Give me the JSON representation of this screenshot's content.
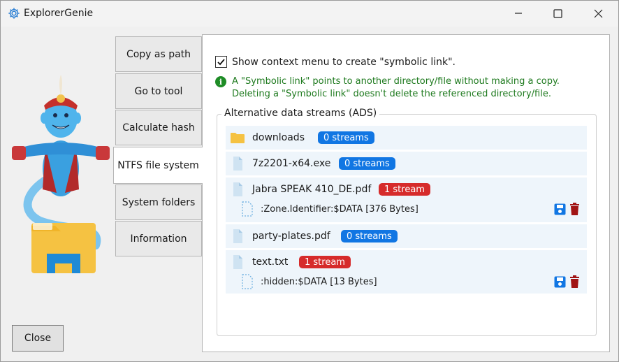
{
  "window": {
    "title": "ExplorerGenie"
  },
  "tabs": [
    {
      "label": "Copy as path"
    },
    {
      "label": "Go to tool"
    },
    {
      "label": "Calculate hash"
    },
    {
      "label": "NTFS file system"
    },
    {
      "label": "System folders"
    },
    {
      "label": "Information"
    }
  ],
  "active_tab": "NTFS file system",
  "panel": {
    "checkbox_label": "Show context menu to create \"symbolic link\".",
    "checkbox_checked": true,
    "info_text": "A \"Symbolic link\" points to another directory/file without making a copy. Deleting a \"Symbolic link\" doesn't delete the referenced directory/file.",
    "ads_title": "Alternative data streams (ADS)",
    "items": [
      {
        "name": "downloads",
        "badge": "0 streams",
        "badge_color": "#1176e3",
        "kind": "folder-icon"
      },
      {
        "name": "7z2201-x64.exe",
        "badge": "0 streams",
        "badge_color": "#1176e3",
        "kind": "file-icon"
      },
      {
        "name": "Jabra SPEAK 410_DE.pdf",
        "badge": "1 stream",
        "badge_color": "#d62b2b",
        "kind": "file-icon",
        "stream": ":Zone.Identifier:$DATA [376 Bytes]"
      },
      {
        "name": "party-plates.pdf",
        "badge": "0 streams",
        "badge_color": "#1176e3",
        "kind": "file-icon"
      },
      {
        "name": "text.txt",
        "badge": "1 stream",
        "badge_color": "#d62b2b",
        "kind": "file-icon",
        "stream": ":hidden:$DATA [13 Bytes]"
      }
    ]
  },
  "footer": {
    "close_label": "Close"
  },
  "colors": {
    "accent_blue": "#1176e3",
    "danger_red": "#d62b2b",
    "info_green": "#1e7a1e",
    "trash_red": "#a11414"
  }
}
